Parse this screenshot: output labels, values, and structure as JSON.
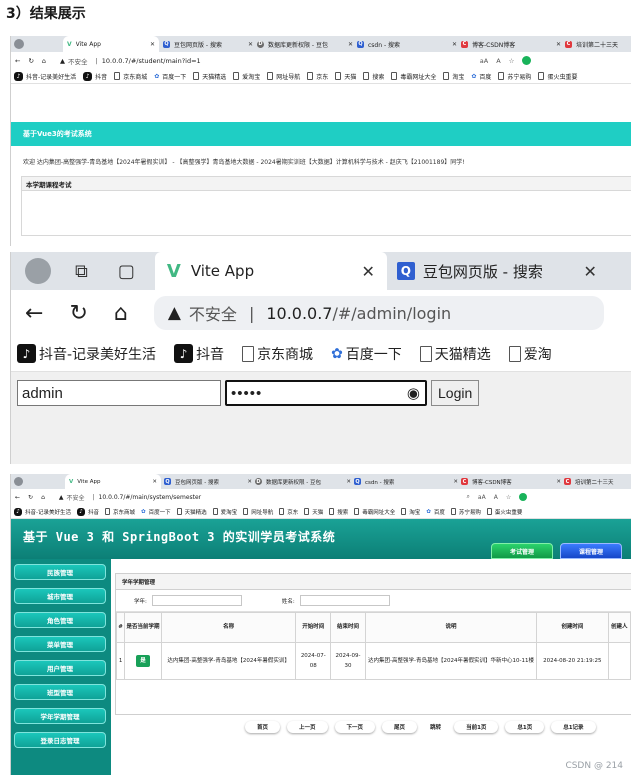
{
  "heading": "3）结果展示",
  "shared": {
    "tabs": [
      {
        "icon": "vue",
        "title": "Vite App"
      },
      {
        "icon": "search",
        "title": "豆包网页版 - 搜索"
      },
      {
        "icon": "db",
        "title": "数据库更新权限 - 豆包"
      },
      {
        "icon": "search",
        "title": "csdn - 搜索"
      },
      {
        "icon": "csdn",
        "title": "博客-CSDN博客"
      },
      {
        "icon": "csdn",
        "title": "培训第二十三天"
      }
    ],
    "not_secure": "不安全",
    "bookmarks": [
      "抖音-记录美好生活",
      "抖音",
      "京东商城",
      "百度一下",
      "天猫精选",
      "爱淘宝",
      "网址导航",
      "京东",
      "天猫",
      "搜索",
      "毒霸网址大全",
      "淘宝",
      "百度",
      "苏宁易购",
      "蛋火虫重要"
    ],
    "aa": "aA",
    "readaloud": "A",
    "star": "☆"
  },
  "section1": {
    "url": "10.0.0.7/#/student/main?id=1",
    "header": "基于Vue3的考试系统",
    "welcome": "欢迎 达内集团-高整强学-青岛基地【2024年暑假实训】 - 【高整强学】青岛基地大数据 - 2024暑期实训班【大数据】计算机科学与技术 - 赵庆飞【21001189】同学!",
    "card_title": "本学期课程考试"
  },
  "section2": {
    "tab_vite": "Vite App",
    "tab_doubao": "豆包网页版 - 搜索",
    "not_secure": "不安全",
    "url_host": "10.0.0.7",
    "url_path": "/#/admin/login",
    "bookmarks": [
      "抖音-记录美好生活",
      "抖音",
      "京东商城",
      "百度一下",
      "天猫精选",
      "爱淘"
    ],
    "username": "admin",
    "password": "•••••",
    "login_button": "Login"
  },
  "section3": {
    "url": "10.0.0.7/#/main/system/semester",
    "title": "基于 Vue 3 和 SpringBoot 3 的实训学员考试系统",
    "top_buttons": [
      "考试管理",
      "课程管理"
    ],
    "sidebar": [
      "民族管理",
      "城市管理",
      "角色管理",
      "菜单管理",
      "用户管理",
      "班型管理",
      "学年学期管理",
      "登录日志管理"
    ],
    "panel_title": "学年学期管理",
    "filter_labels": [
      "学年:",
      "姓名:"
    ],
    "columns": [
      "#",
      "是否当前学期",
      "名称",
      "开始时间",
      "结束时间",
      "说明",
      "创建时间",
      "创建人"
    ],
    "row": {
      "index": "1",
      "current": "是",
      "name": "达内集团-高整强学-青岛基地【2024年暑假实训】",
      "start": "2024-07-08",
      "end": "2024-09-30",
      "desc": "达内集团-高整强学-青岛基地【2024年暑假实训】华新中心10-11楼",
      "created": "2024-08-20 21:19:25",
      "creator": ""
    },
    "pager": [
      "首页",
      "上一页",
      "下一页",
      "尾页"
    ],
    "jump_label": "跳转",
    "pager_info": [
      "当前1页",
      "总1页",
      "总1记录"
    ],
    "watermark": "CSDN @ 214"
  },
  "colors": {
    "accent": "#1fcec4",
    "header_green": "#0c7f76",
    "sidebar": "#0d8a80",
    "tag_green": "#18a058"
  }
}
